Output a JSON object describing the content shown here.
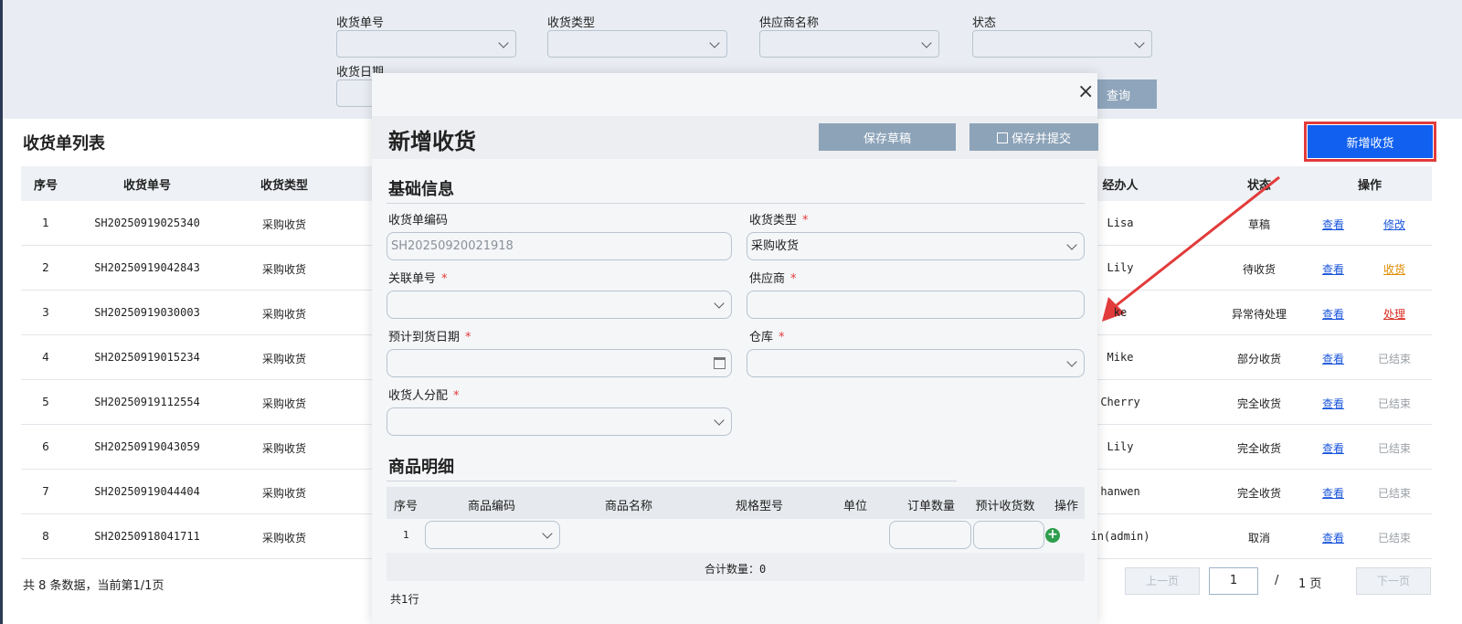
{
  "filters": {
    "order_no_label": "收货单号",
    "type_label": "收货类型",
    "supplier_label": "供应商名称",
    "status_label": "状态",
    "date_label": "收货日期",
    "query_button": "查询"
  },
  "list": {
    "title": "收货单列表",
    "add_button": "新增收货",
    "columns": {
      "index": "序号",
      "order_no": "收货单号",
      "type": "收货类型",
      "handler": "经办人",
      "status": "状态",
      "actions": "操作"
    },
    "rows": [
      {
        "index": "1",
        "order_no": "SH20250919025340",
        "type": "采购收货",
        "handler": "Lisa",
        "status": "草稿",
        "view": "查看",
        "action": "修改",
        "action_style": "blue"
      },
      {
        "index": "2",
        "order_no": "SH20250919042843",
        "type": "采购收货",
        "handler": "Lily",
        "status": "待收货",
        "view": "查看",
        "action": "收货",
        "action_style": "orange"
      },
      {
        "index": "3",
        "order_no": "SH20250919030003",
        "type": "采购收货",
        "handler": "ke",
        "status": "异常待处理",
        "view": "查看",
        "action": "处理",
        "action_style": "red"
      },
      {
        "index": "4",
        "order_no": "SH20250919015234",
        "type": "采购收货",
        "handler": "Mike",
        "status": "部分收货",
        "view": "查看",
        "action": "已结束",
        "action_style": "done"
      },
      {
        "index": "5",
        "order_no": "SH20250919112554",
        "type": "采购收货",
        "handler": "Cherry",
        "status": "完全收货",
        "view": "查看",
        "action": "已结束",
        "action_style": "done"
      },
      {
        "index": "6",
        "order_no": "SH20250919043059",
        "type": "采购收货",
        "handler": "Lily",
        "status": "完全收货",
        "view": "查看",
        "action": "已结束",
        "action_style": "done"
      },
      {
        "index": "7",
        "order_no": "SH20250919044404",
        "type": "采购收货",
        "handler": "hanwen",
        "status": "完全收货",
        "view": "查看",
        "action": "已结束",
        "action_style": "done"
      },
      {
        "index": "8",
        "order_no": "SH20250918041711",
        "type": "采购收货",
        "handler": "in(admin)",
        "status": "取消",
        "view": "查看",
        "action": "已结束",
        "action_style": "done"
      }
    ],
    "footer": "共 8 条数据，当前第1/1页",
    "pager": {
      "prev": "上一页",
      "page": "1",
      "slash": "/",
      "total": "1 页",
      "next": "下一页"
    }
  },
  "modal": {
    "title": "新增收货",
    "close": "×",
    "save_draft": "保存草稿",
    "save_submit": "保存并提交",
    "basic_section": "基础信息",
    "fields": {
      "code_label": "收货单编码",
      "code_value": "SH2025092002191​8",
      "type_label": "收货类型",
      "type_value": "采购收货",
      "related_label": "关联单号",
      "supplier_label": "供应商",
      "eta_label": "预计到货日期",
      "warehouse_label": "仓库",
      "assignee_label": "收货人分配",
      "required": "*"
    },
    "detail_section": "商品明细",
    "detail_columns": {
      "index": "序号",
      "code": "商品编码",
      "name": "商品名称",
      "spec": "规格型号",
      "unit": "单位",
      "order_qty": "订单数量",
      "expected_qty": "预计收货数",
      "action": "操作"
    },
    "detail_row_index": "1",
    "sum_text": "合计数量：0",
    "total_rows": "共1行"
  },
  "colors": {
    "primary": "#1160f0",
    "highlight": "#e23b3b",
    "muted_button": "#8da3b8"
  }
}
